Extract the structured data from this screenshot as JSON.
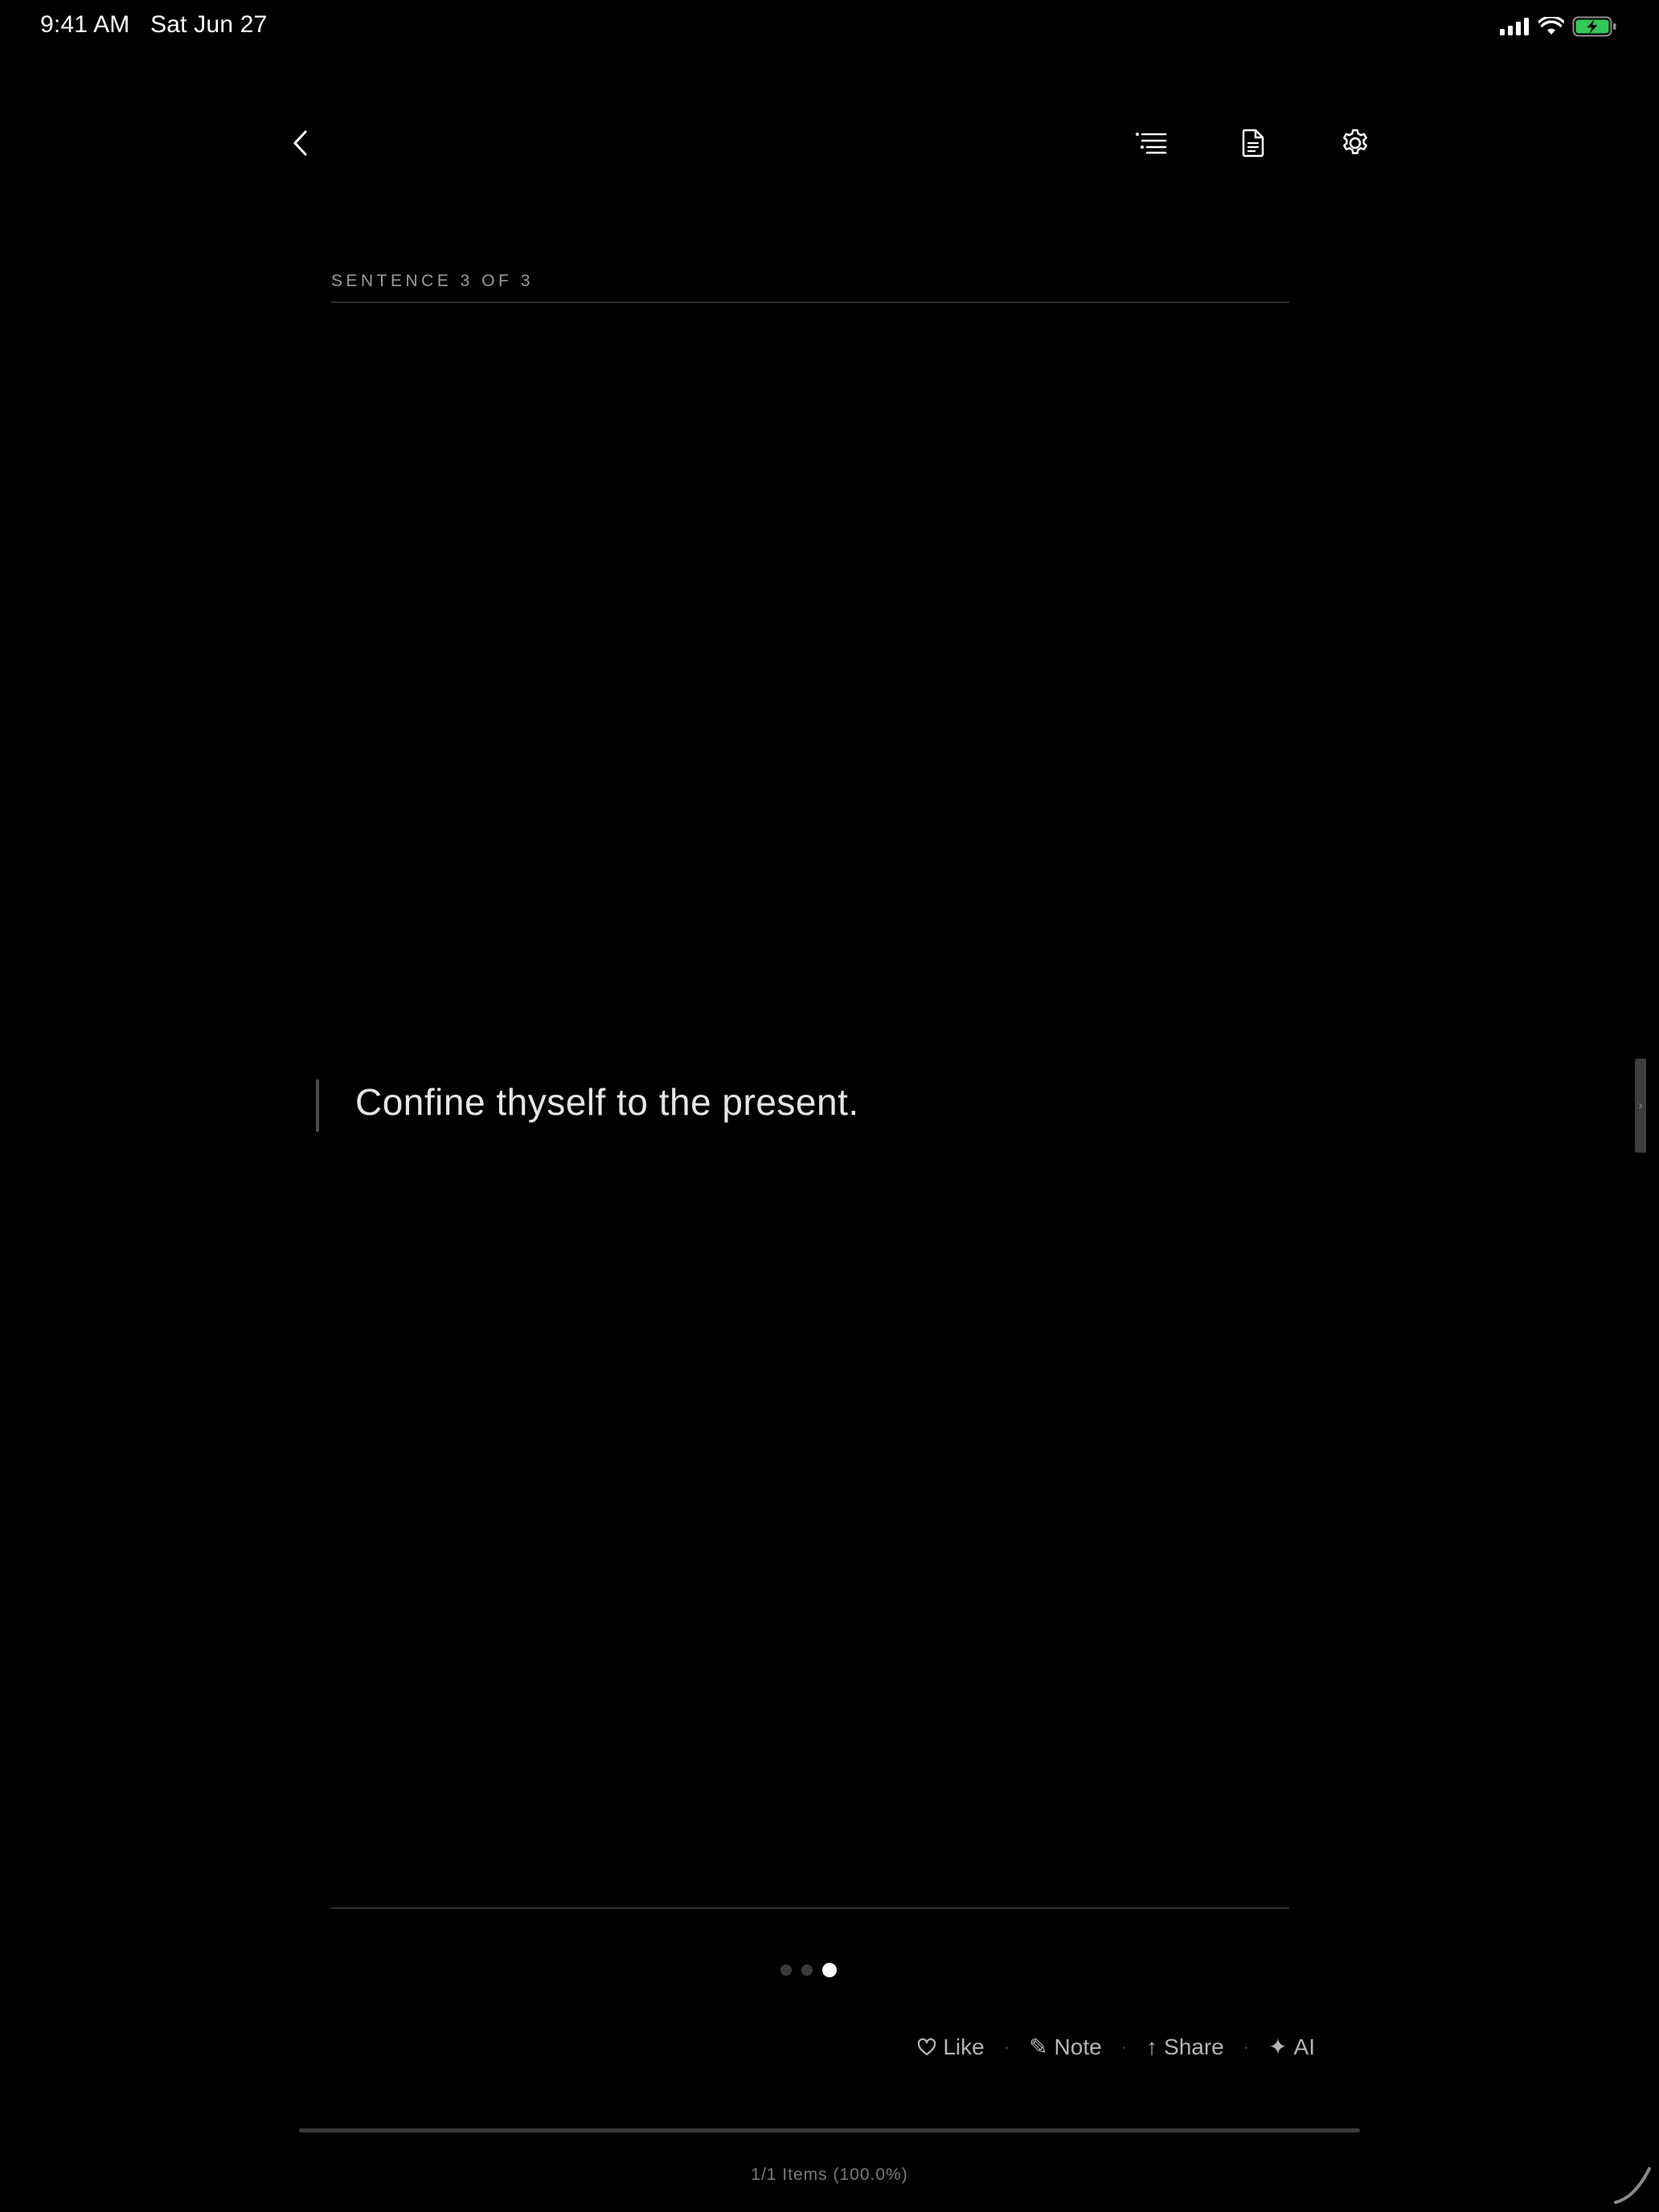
{
  "status_bar": {
    "time": "9:41 AM",
    "date": "Sat Jun 27",
    "battery_color": "#34c759"
  },
  "toolbar": {
    "back_icon": "chevron-left-icon",
    "toc_icon": "list-icon",
    "document_icon": "document-icon",
    "settings_icon": "gear-icon"
  },
  "reader": {
    "sentence_label": "SENTENCE 3 OF 3",
    "quote": "Confine thyself to the present.",
    "side_handle_glyph": "›"
  },
  "pagination": {
    "total": 3,
    "current": 3
  },
  "actions": {
    "like_label": "Like",
    "note_label": "Note",
    "share_label": "Share",
    "ai_label": "AI",
    "note_glyph": "✎",
    "share_glyph": "↑",
    "ai_glyph": "✦",
    "separator": "·"
  },
  "progress": {
    "fraction": 1.0,
    "label": "1/1 Items (100.0%)"
  }
}
